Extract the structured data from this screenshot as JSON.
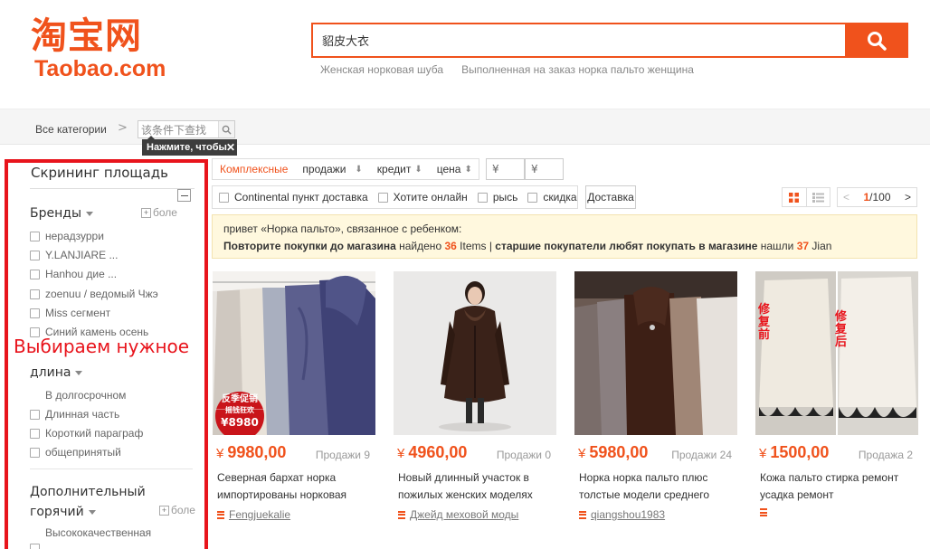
{
  "logo": {
    "cn": "淘宝网",
    "en": "Taobao.com"
  },
  "search": {
    "value": "貂皮大衣",
    "suggestions": [
      "Женская норковая шуба",
      "Выполненная на заказ норка пальто женщина"
    ]
  },
  "catbar": {
    "all_categories": "Все категории",
    "separator": ">",
    "filter_value": "该条件下查找",
    "tooltip": "Нажмите, чтобы",
    "tooltip_close": "✕"
  },
  "sidebar": {
    "title": "Скрининг площадь",
    "brands": {
      "title": "Бренды",
      "more": "боле",
      "items": [
        "нерадзурри",
        "Y.LANJIARE ...",
        "Hanhou дие ...",
        "zoenuu / ведомый Чжэ",
        "Miss сегмент",
        "Синий камень осень"
      ]
    },
    "annotation": "Выбираем нужное",
    "length": {
      "title": "длина",
      "items": [
        "В долгосрочном",
        "Длинная часть",
        "Короткий параграф",
        "общепринятый"
      ]
    },
    "extra": {
      "title_line1": "Дополнительный",
      "title_line2": "горячий",
      "more": "боле",
      "items": [
        "Высококачественная"
      ]
    }
  },
  "sort": {
    "items": [
      "Комплексные",
      "продажи",
      "кредит",
      "цена"
    ],
    "price_from": "¥",
    "price_to": "¥"
  },
  "filters": {
    "items": [
      "Continental пункт доставка",
      "Хотите онлайн",
      "рысь",
      "скидка"
    ],
    "delivery": "Доставка"
  },
  "pager": {
    "prev": "<",
    "current": "1",
    "total": "/100",
    "next": ">"
  },
  "notice": {
    "line1": "привет «Норка пальто», связанное с ребенком:",
    "line2_a": "Повторите покупки до магазина",
    "line2_b": " найдено ",
    "count1": "36",
    "line2_c": " Items | ",
    "line2_d": "старшие покупатели любят покупать в магазине",
    "line2_e": " нашли ",
    "count2": "37",
    "line2_f": " Jian"
  },
  "products": [
    {
      "price": "9980,00",
      "currency": "¥",
      "sales": "Продажи 9",
      "title": "Северная бархат норка импортированы норковая",
      "shop": "Fengjuekalie",
      "badge_line1": "反季促销",
      "badge_line2": "摇钱狂欢",
      "badge_price": "¥8980"
    },
    {
      "price": "4960,00",
      "currency": "¥",
      "sales": "Продажи 0",
      "title": "Новый длинный участок в пожилых женских моделях",
      "shop": "Джейд меховой моды"
    },
    {
      "price": "5980,00",
      "currency": "¥",
      "sales": "Продажи 24",
      "title": "Норка норка пальто плюс толстые модели среднего",
      "shop": "qiangshou1983"
    },
    {
      "price": "1500,00",
      "currency": "¥",
      "sales": "Продажа 2",
      "title": "Кожа пальто стирка ремонт усадка ремонт",
      "shop": "",
      "label_before": "修复前",
      "label_after": "修复后"
    }
  ],
  "colors": {
    "accent": "#f0521c",
    "annotation": "#e8141c"
  }
}
